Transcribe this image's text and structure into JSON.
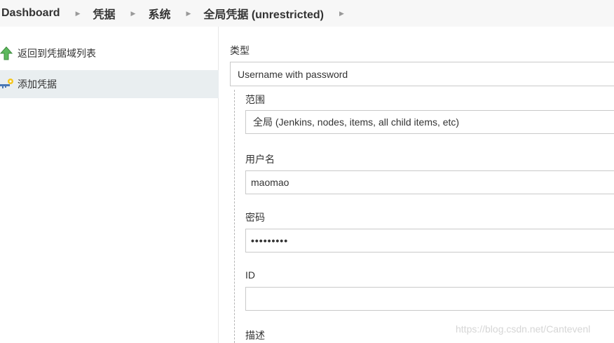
{
  "breadcrumb": {
    "items": [
      "Dashboard",
      "凭据",
      "系统",
      "全局凭据 (unrestricted)"
    ]
  },
  "sidebar": {
    "back_label": "返回到凭据域列表",
    "add_label": "添加凭据",
    "back_icon": "up-arrow-icon",
    "add_icon": "key-icon"
  },
  "form": {
    "kind_label": "类型",
    "kind_value": "Username with password",
    "scope_label": "范围",
    "scope_value": "全局 (Jenkins, nodes, items, all child items, etc)",
    "username_label": "用户名",
    "username_value": "maomao",
    "password_label": "密码",
    "password_value": "•••••••••",
    "id_label": "ID",
    "id_value": "",
    "description_label": "描述"
  },
  "watermark": "https://blog.csdn.net/Cantevenl",
  "colors": {
    "breadcrumb_bg": "#f7f7f7",
    "sidebar_active_bg": "#e9eef0",
    "input_border": "#c9c9c9",
    "icon_green": "#5cb85c",
    "key_blue": "#4a78b5",
    "key_yellow": "#f5c61e"
  }
}
